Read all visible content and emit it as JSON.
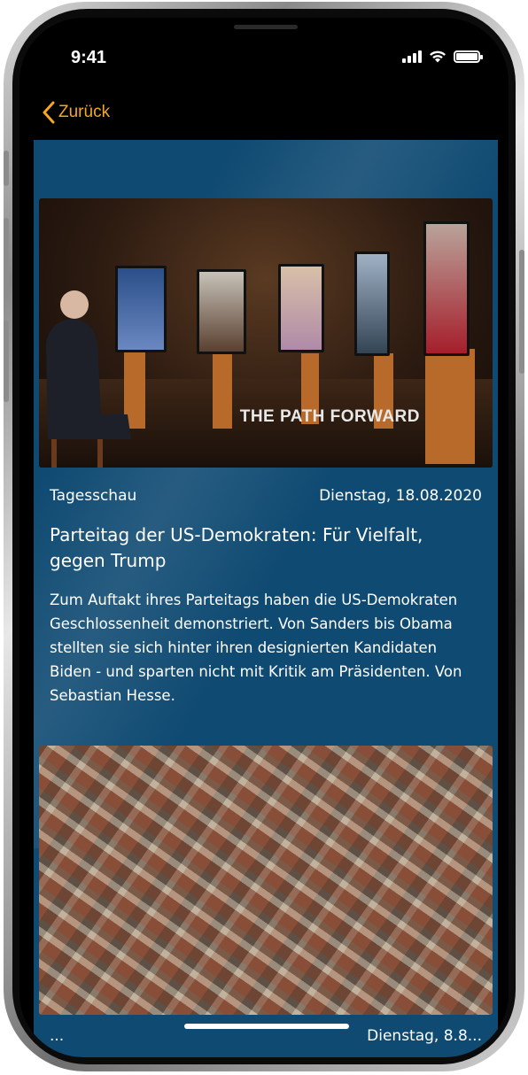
{
  "status_bar": {
    "time": "9:41"
  },
  "nav": {
    "back_label": "Zurück"
  },
  "articles": [
    {
      "source": "Tagesschau",
      "date": "Dienstag, 18.08.2020",
      "image_caption": "THE PATH FORWARD",
      "headline": "Parteitag der US-Demokraten: Für Vielfalt, gegen Trump",
      "teaser": "Zum Auftakt ihres Parteitags haben die US-Demokraten Geschlossenheit demonstriert. Von Sanders bis Obama stellten sie sich hinter ihren designierten Kandidaten Biden - und sparten nicht mit Kritik am Präsidenten. Von Sebastian Hesse."
    },
    {
      "source": "...",
      "date": "Dienstag, 8.8..."
    }
  ],
  "colors": {
    "accent": "#f5a623",
    "content_bg": "#0f4a72",
    "text": "#ffffff"
  },
  "icons": [
    "signal-icon",
    "wifi-icon",
    "battery-icon",
    "chevron-left-icon"
  ]
}
